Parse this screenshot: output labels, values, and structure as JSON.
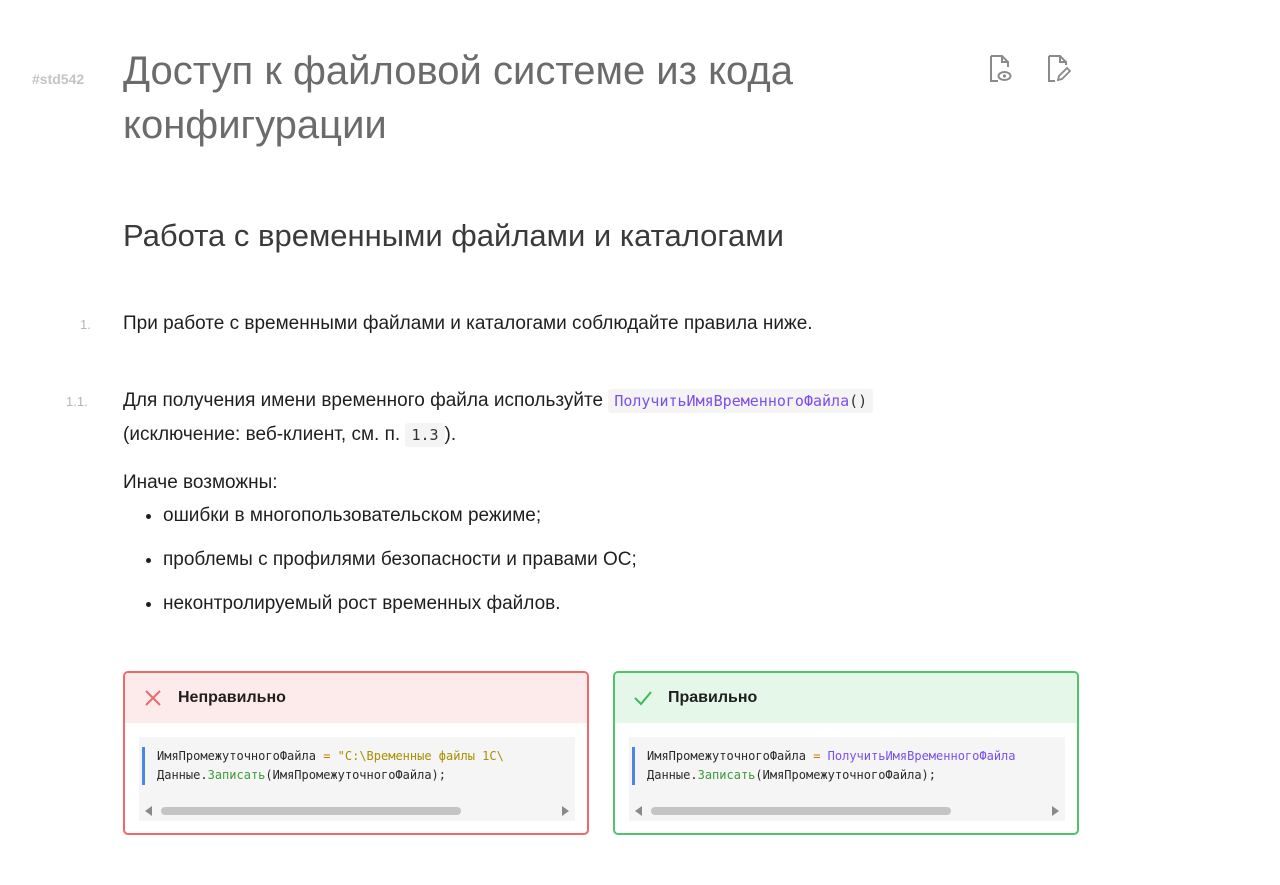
{
  "doc_id": "#std542",
  "title": "Доступ к файловой системе из кода конфигурации",
  "actions": [
    {
      "icon": "view-file-icon"
    },
    {
      "icon": "edit-file-icon"
    }
  ],
  "section": {
    "title": "Работа с временными файлами и каталогами"
  },
  "items": [
    {
      "num": "1.",
      "text": "При работе с временными файлами и каталогами соблюдайте правила ниже."
    },
    {
      "num": "1.1.",
      "text_before": "Для получения имени временного файла используйте",
      "code_fn": "ПолучитьИмяВременногоФайла",
      "code_parens": "()",
      "line2_before": "(исключение: веб-клиент, см. п.",
      "line2_code": "1.3",
      "line2_after": ")."
    }
  ],
  "otherwise_label": "Иначе возможны:",
  "bullets": [
    "ошибки в многопользовательском режиме;",
    "проблемы с профилями безопасности и правами ОС;",
    "неконтролируемый рост временных файлов."
  ],
  "examples": {
    "bad": {
      "label": "Неправильно",
      "icon": "cross-icon",
      "color": "#ee6a6a",
      "line1_var": "ИмяПромежуточногоФайла",
      "line1_op": "=",
      "line1_value": "\"C:\\Временные файлы 1С\\",
      "line2_obj": "Данные",
      "line2_method": "Записать",
      "line2_args": "(ИмяПромежуточногоФайла);"
    },
    "good": {
      "label": "Правильно",
      "icon": "check-icon",
      "color": "#4fc46c",
      "line1_var": "ИмяПромежуточногоФайла",
      "line1_op": "=",
      "line1_value": "ПолучитьИмяВременногоФайла",
      "line2_obj": "Данные",
      "line2_method": "Записать",
      "line2_args": "(ИмяПромежуточногоФайла);"
    }
  }
}
